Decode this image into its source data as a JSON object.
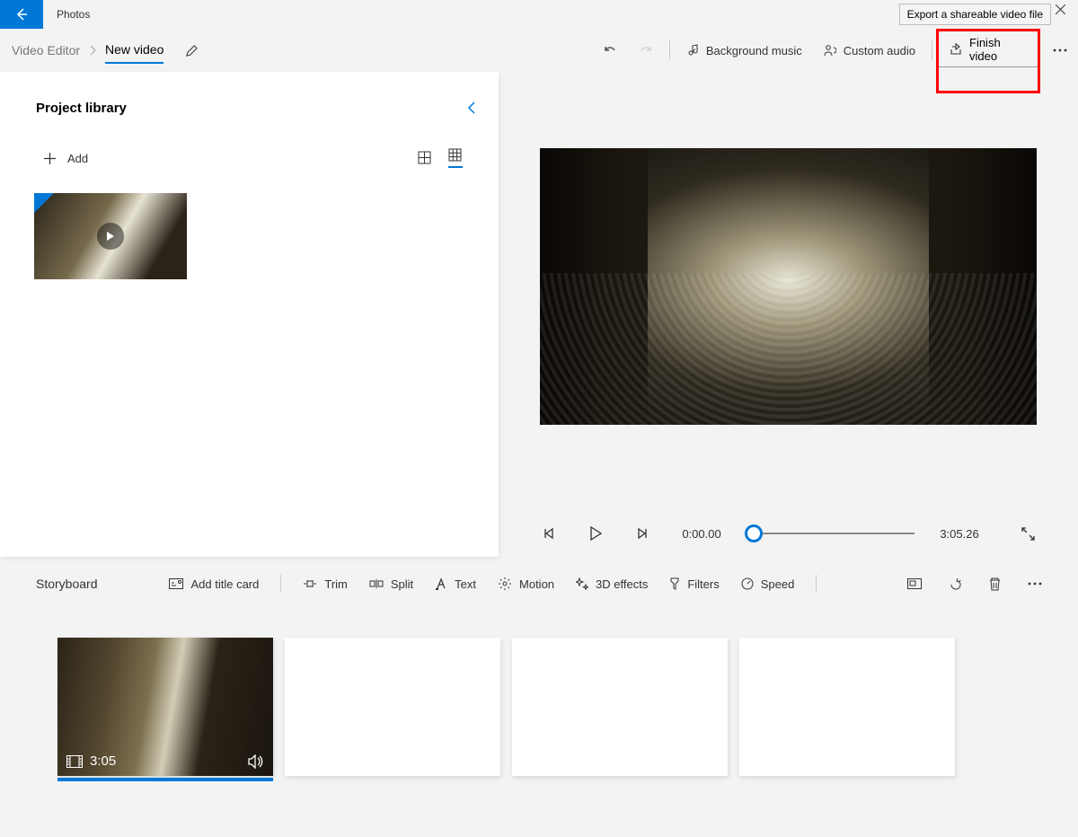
{
  "app": {
    "title": "Photos"
  },
  "tooltip": "Export a shareable video file",
  "breadcrumb": {
    "root": "Video Editor",
    "current": "New video"
  },
  "toolbar": {
    "bg_music": "Background music",
    "custom_audio": "Custom audio",
    "finish": "Finish video"
  },
  "library": {
    "title": "Project library",
    "add": "Add"
  },
  "playback": {
    "current": "0:00.00",
    "total": "3:05.26"
  },
  "storyboard": {
    "title": "Storyboard",
    "title_card": "Add title card",
    "trim": "Trim",
    "split": "Split",
    "text": "Text",
    "motion": "Motion",
    "three_d": "3D effects",
    "filters": "Filters",
    "speed": "Speed",
    "clip_duration": "3:05"
  }
}
